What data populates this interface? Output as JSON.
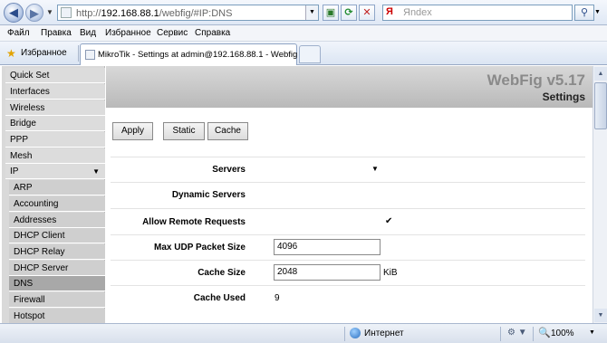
{
  "browser": {
    "url_prefix": "http://",
    "url_host": "192.168.88.1",
    "url_path": "/webfig/#IP:DNS",
    "search_placeholder": "Яndex",
    "search_logo": "Я",
    "menu": [
      "Файл",
      "Правка",
      "Вид",
      "Избранное",
      "Сервис",
      "Справка"
    ],
    "favorites_label": "Избранное",
    "tab_title": "MikroTik - Settings at admin@192.168.88.1 - Webfig ...",
    "status_zone": "Интернет",
    "zoom": "100%"
  },
  "sidebar": {
    "items": [
      "Quick Set",
      "Interfaces",
      "Wireless",
      "Bridge",
      "PPP",
      "Mesh",
      "IP"
    ],
    "ip_submenu": [
      "ARP",
      "Accounting",
      "Addresses",
      "DHCP Client",
      "DHCP Relay",
      "DHCP Server",
      "DNS",
      "Firewall",
      "Hotspot"
    ],
    "selected": "DNS"
  },
  "header": {
    "brand": "WebFig v5.17",
    "title": "Settings"
  },
  "buttons": {
    "apply": "Apply",
    "static": "Static",
    "cache": "Cache"
  },
  "form": {
    "servers_label": "Servers",
    "dynamic_servers_label": "Dynamic Servers",
    "allow_remote_label": "Allow Remote Requests",
    "allow_remote_checked": true,
    "max_udp_label": "Max UDP Packet Size",
    "max_udp_value": "4096",
    "cache_size_label": "Cache Size",
    "cache_size_value": "2048",
    "cache_size_unit": "KiB",
    "cache_used_label": "Cache Used",
    "cache_used_value": "9"
  }
}
